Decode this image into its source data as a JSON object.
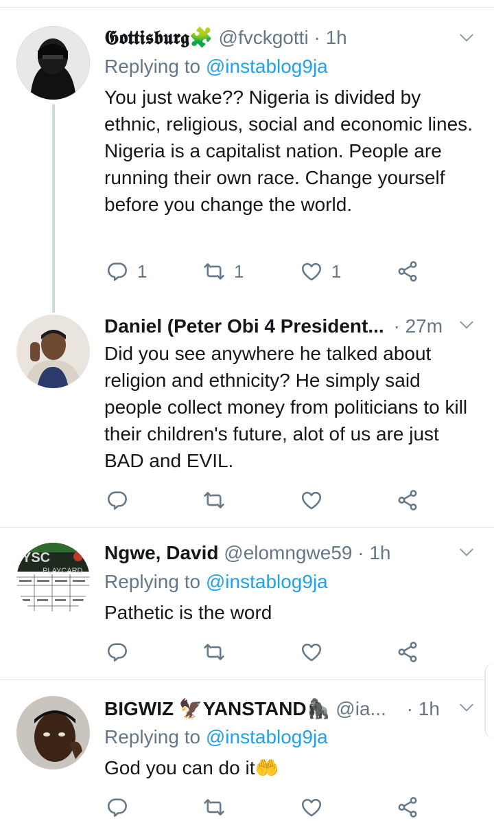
{
  "tweets": [
    {
      "name": "𝕲𝖔𝖙𝖙𝖎𝖘𝖇𝖚𝖗𝖌🧩",
      "handle": "@fvckgotti",
      "dot": "·",
      "time": "1h",
      "replying_prefix": "Replying to ",
      "replying_to": "@instablog9ja",
      "text": "You just wake?? Nigeria is divided by ethnic, religious, social and economic lines. Nigeria is a capitalist nation. People are running their own race. Change yourself before you change the world.",
      "reply_count": "1",
      "retweet_count": "1",
      "like_count": "1"
    },
    {
      "name": "Daniel (Peter Obi 4 President...",
      "handle": "",
      "dot": "·",
      "time": "27m",
      "text": "Did you see anywhere he talked about religion and ethnicity? He simply said people collect money from politicians to kill their children's future, alot of us are just BAD and EVIL.",
      "reply_count": "",
      "retweet_count": "",
      "like_count": ""
    },
    {
      "name": "Ngwe, David",
      "handle": "@elomngwe59",
      "dot": "·",
      "time": "1h",
      "replying_prefix": "Replying to ",
      "replying_to": "@instablog9ja",
      "text": "Pathetic is the word",
      "reply_count": "",
      "retweet_count": "",
      "like_count": "",
      "avatar_text_1": "YSC",
      "avatar_text_2": "PLAYCARD"
    },
    {
      "name": "BIGWIZ 🦅YANSTAND🦍",
      "handle": "@ia...",
      "dot": "·",
      "time": "1h",
      "replying_prefix": "Replying to ",
      "replying_to": "@instablog9ja",
      "text": "God you can do it🤲",
      "reply_count": "",
      "retweet_count": "",
      "like_count": ""
    }
  ],
  "icons": {
    "reply": "reply-icon",
    "retweet": "retweet-icon",
    "like": "heart-icon",
    "share": "share-icon",
    "menu": "chevron-down-icon"
  },
  "colors": {
    "accent": "#1da1f2",
    "secondary_text": "#657786",
    "divider": "#e1e8ed"
  }
}
